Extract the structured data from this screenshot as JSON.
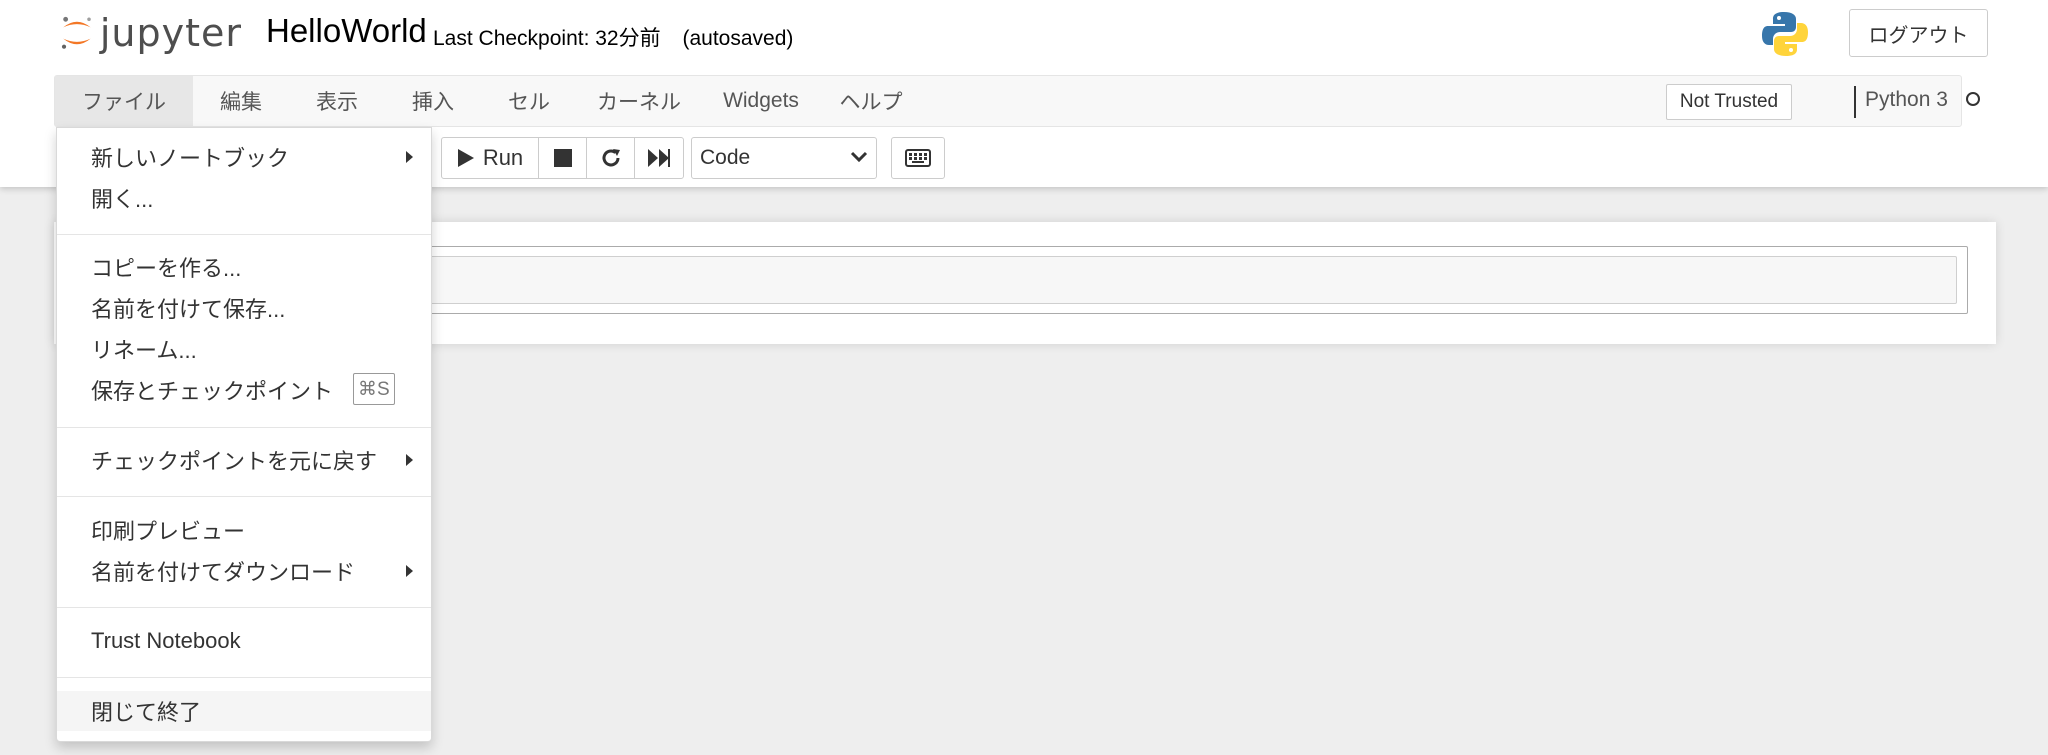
{
  "header": {
    "logo_text": "jupyter",
    "notebook_title": "HelloWorld",
    "checkpoint_text": "Last Checkpoint: 32分前",
    "autosave_status": "(autosaved)",
    "logout_label": "ログアウト"
  },
  "menubar": {
    "items": [
      "ファイル",
      "編集",
      "表示",
      "挿入",
      "セル",
      "カーネル",
      "Widgets",
      "ヘルプ"
    ],
    "trust_status": "Not Trusted",
    "kernel_name": "Python 3"
  },
  "toolbar": {
    "run_label": "Run",
    "cell_type": "Code"
  },
  "file_menu": {
    "new_notebook": "新しいノートブック",
    "open": "開く...",
    "make_copy": "コピーを作る...",
    "save_as": "名前を付けて保存...",
    "rename": "リネーム...",
    "save_checkpoint": "保存とチェックポイント",
    "save_shortcut": "⌘S",
    "revert_checkpoint": "チェックポイントを元に戻す",
    "print_preview": "印刷プレビュー",
    "download_as": "名前を付けてダウンロード",
    "trust_notebook": "Trust Notebook",
    "close_halt": "閉じて終了"
  },
  "icons": {
    "run": "play-icon",
    "stop": "stop-icon",
    "restart": "restart-icon",
    "run_all": "fast-forward-icon",
    "keyboard": "keyboard-icon",
    "kernel_status": "kernel-idle-circle-icon"
  },
  "colors": {
    "jupyter_orange": "#f37726",
    "menubar_bg": "#f8f8f8",
    "page_bg": "#eeeeee"
  }
}
